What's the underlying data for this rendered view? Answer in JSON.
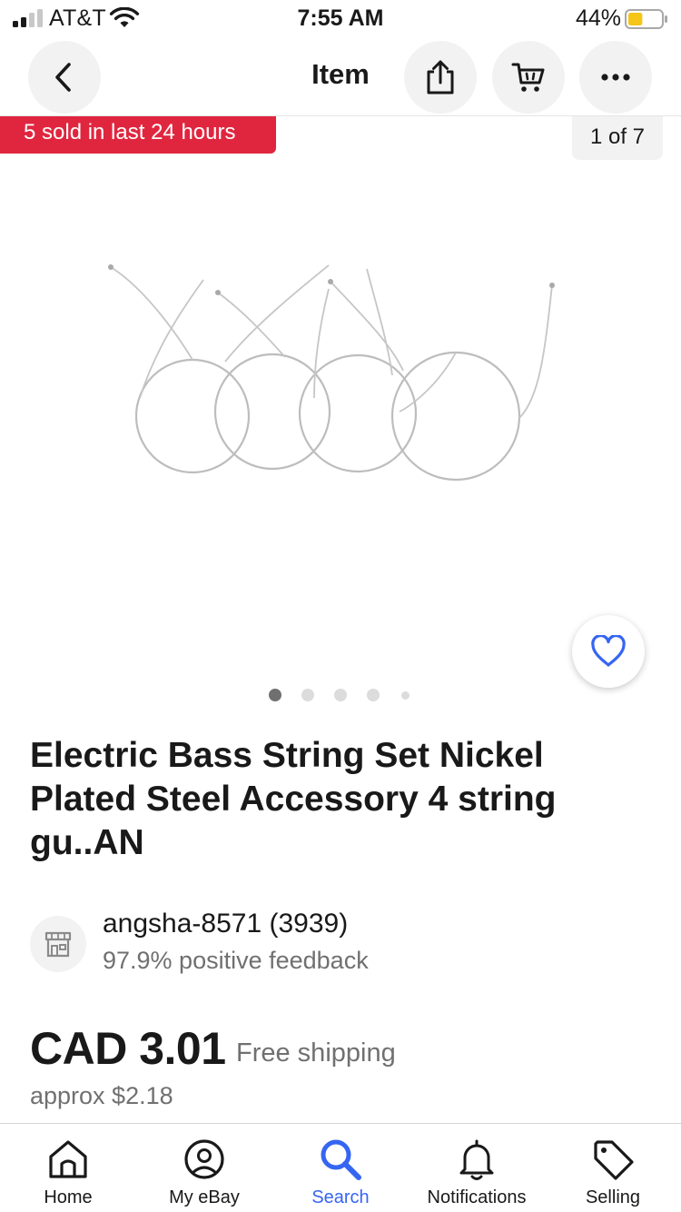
{
  "status_bar": {
    "carrier": "AT&T",
    "time": "7:55 AM",
    "battery_percent": "44%",
    "battery_level": 0.44
  },
  "navbar": {
    "title": "Item",
    "icons": [
      "back-chevron-icon",
      "share-icon",
      "cart-icon",
      "more-icon"
    ]
  },
  "hero": {
    "sold_banner": "5 sold in last 24 hours",
    "image_counter": "1 of 7",
    "image_dots": 5,
    "active_dot": 0
  },
  "listing": {
    "title": "Electric Bass String Set Nickel Plated Steel Accessory 4 string gu..AN"
  },
  "seller": {
    "name": "angsha-8571 (3939)",
    "feedback": "97.9% positive feedback"
  },
  "price": {
    "amount": "CAD 3.01",
    "shipping": "Free shipping",
    "approx": "approx $2.18"
  },
  "tabbar": {
    "active": "search",
    "tabs": [
      {
        "label": "Home",
        "icon": "home-icon"
      },
      {
        "label": "My eBay",
        "icon": "user-circle-icon"
      },
      {
        "label": "Search",
        "icon": "search-icon"
      },
      {
        "label": "Notifications",
        "icon": "bell-icon"
      },
      {
        "label": "Selling",
        "icon": "tag-icon"
      }
    ]
  },
  "colors": {
    "accent": "#3665f3",
    "sold_banner": "#e0263f",
    "battery_fill": "#f5c518",
    "text": "#191919",
    "muted": "#707070"
  }
}
